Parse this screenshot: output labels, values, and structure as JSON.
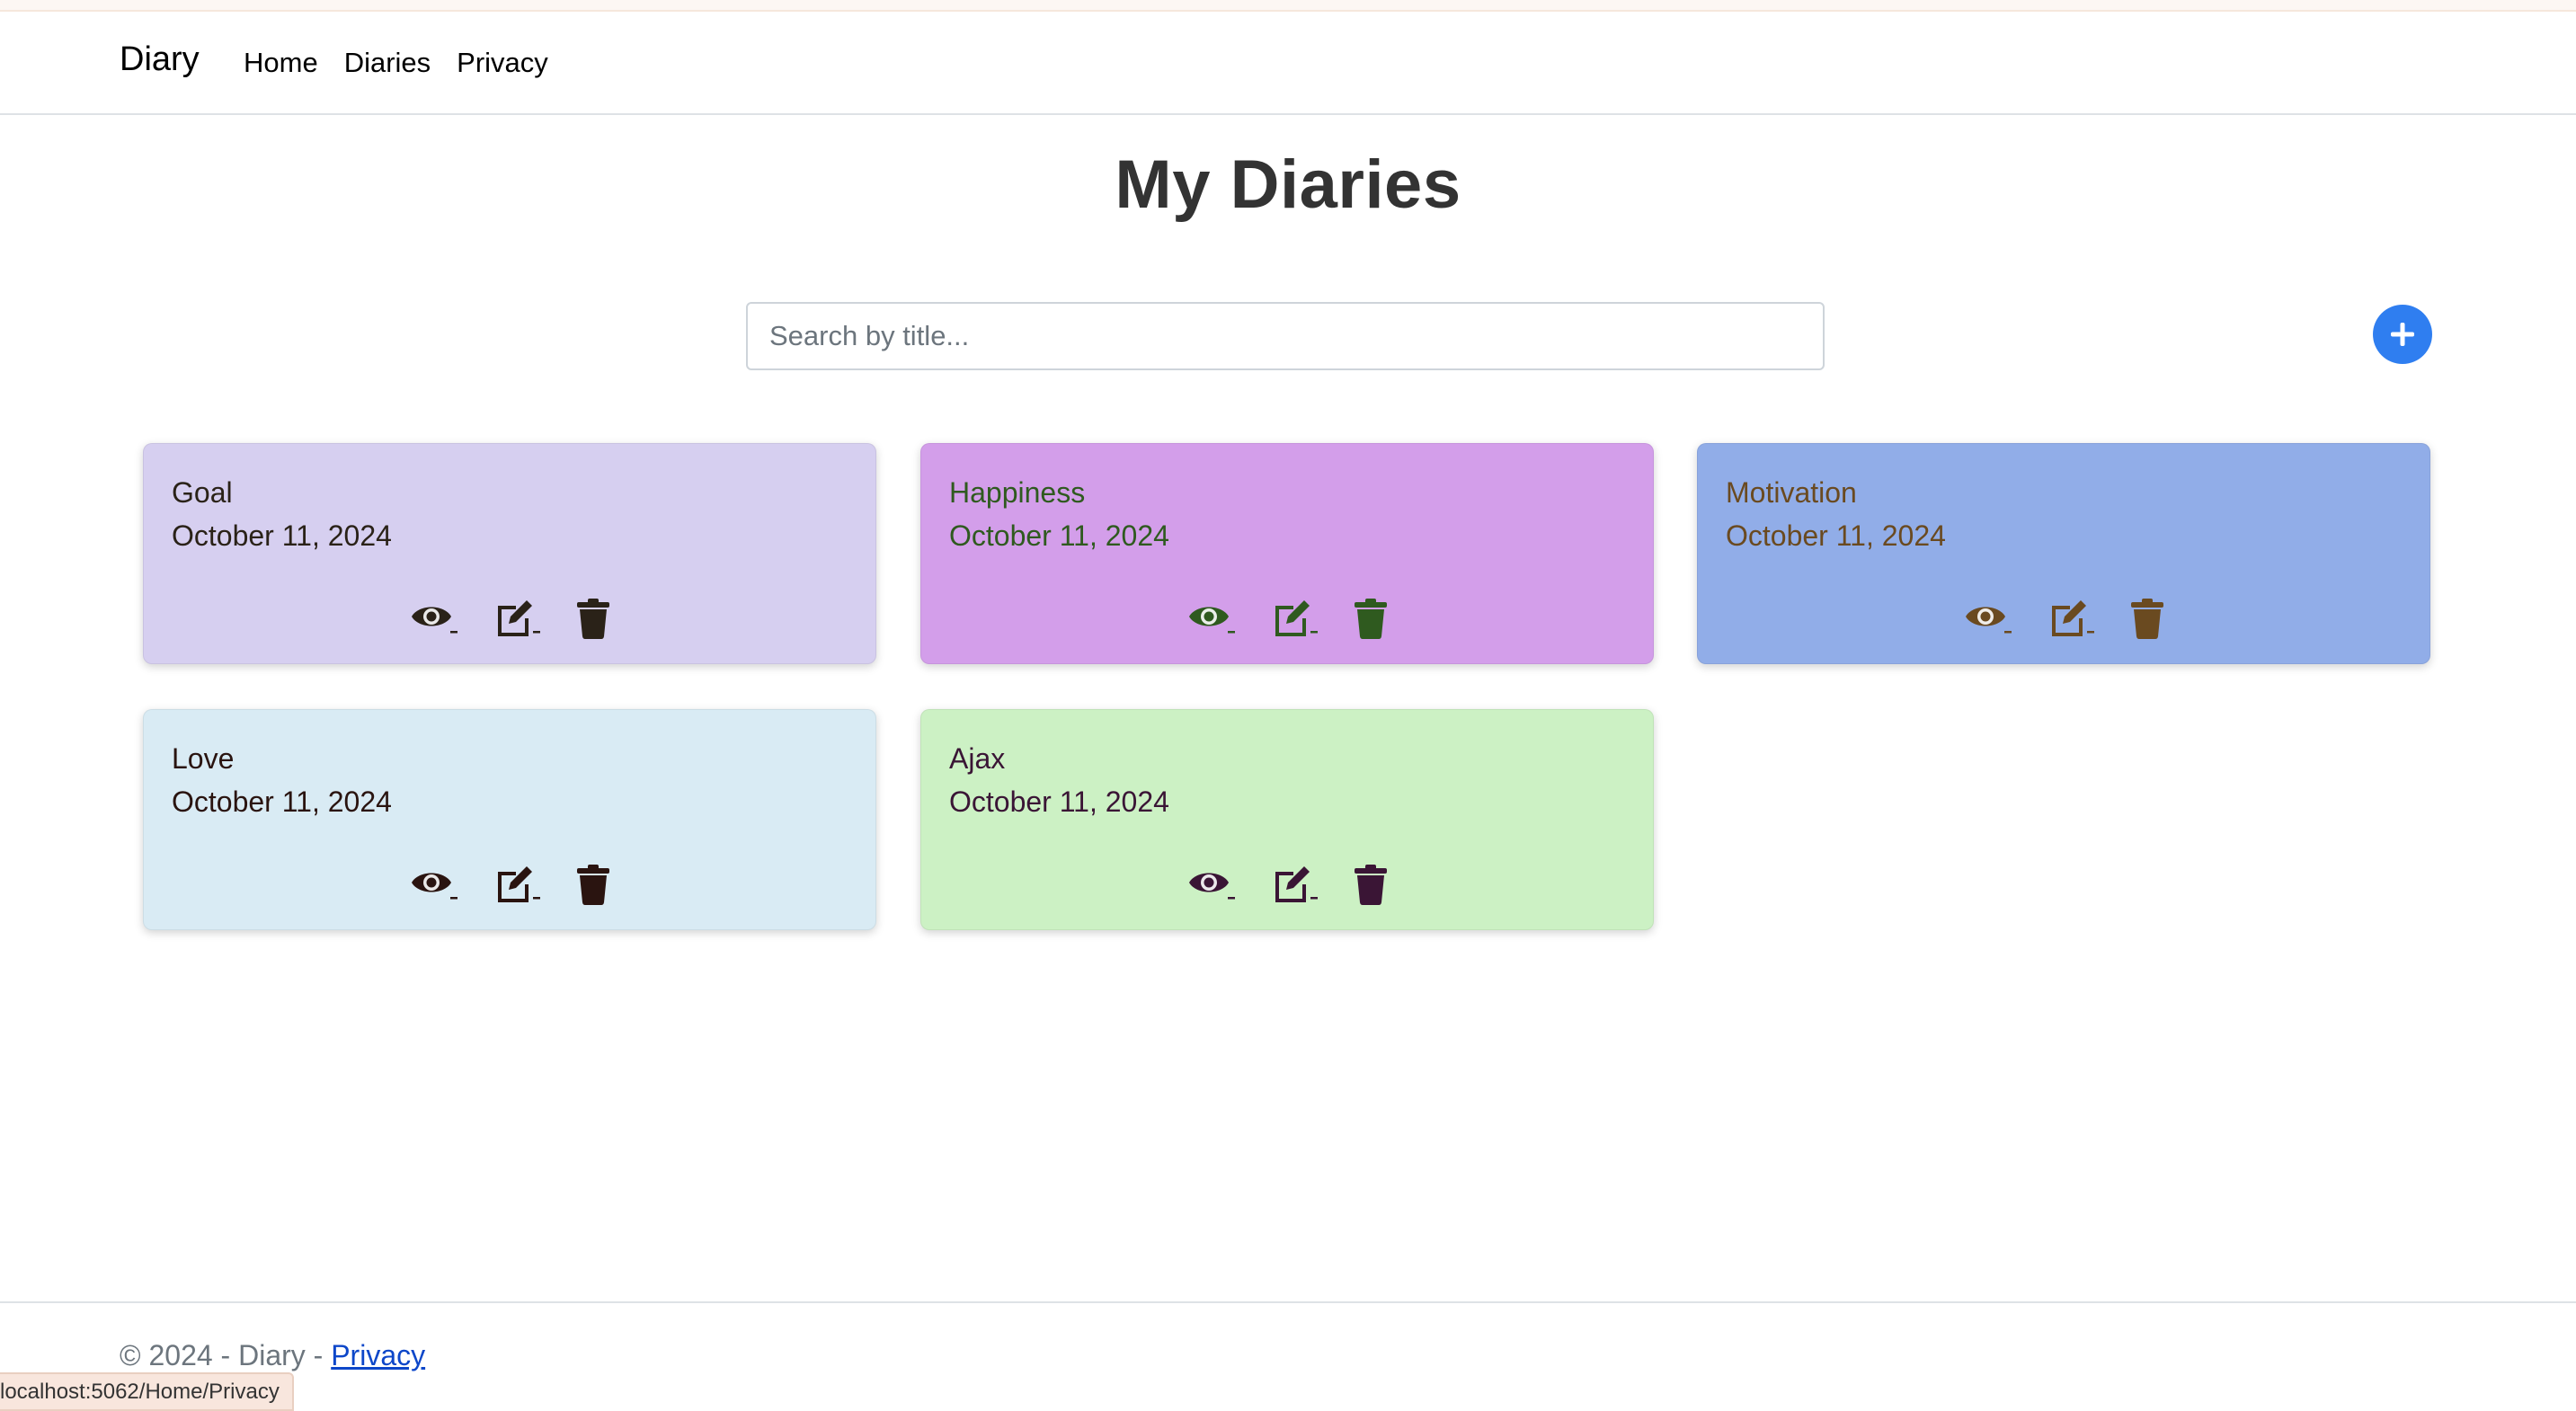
{
  "navbar": {
    "brand": "Diary",
    "links": [
      "Home",
      "Diaries",
      "Privacy"
    ]
  },
  "page": {
    "title": "My Diaries"
  },
  "search": {
    "placeholder": "Search by title...",
    "value": ""
  },
  "add_button": {
    "icon": "plus-circle-icon",
    "color": "#2f7ef0"
  },
  "cards": [
    {
      "title": "Goal",
      "date": "October 11, 2024",
      "bg": "#d6cff0",
      "icon_color": "#2a2218"
    },
    {
      "title": "Happiness",
      "date": "October 11, 2024",
      "bg": "#d39eea",
      "icon_color": "#2f5a1f"
    },
    {
      "title": "Motivation",
      "date": "October 11, 2024",
      "bg": "#91ade8",
      "icon_color": "#6a4a20"
    },
    {
      "title": "Love",
      "date": "October 11, 2024",
      "bg": "#d9ebf4",
      "icon_color": "#2a1410"
    },
    {
      "title": "Ajax",
      "date": "October 11, 2024",
      "bg": "#ccf1c4",
      "icon_color": "#3a1535"
    }
  ],
  "card_actions": [
    "eye-icon",
    "edit-icon",
    "trash-icon"
  ],
  "footer": {
    "text": "© 2024 - Diary - ",
    "link": "Privacy"
  },
  "status_bar": {
    "url": "localhost:5062/Home/Privacy"
  }
}
